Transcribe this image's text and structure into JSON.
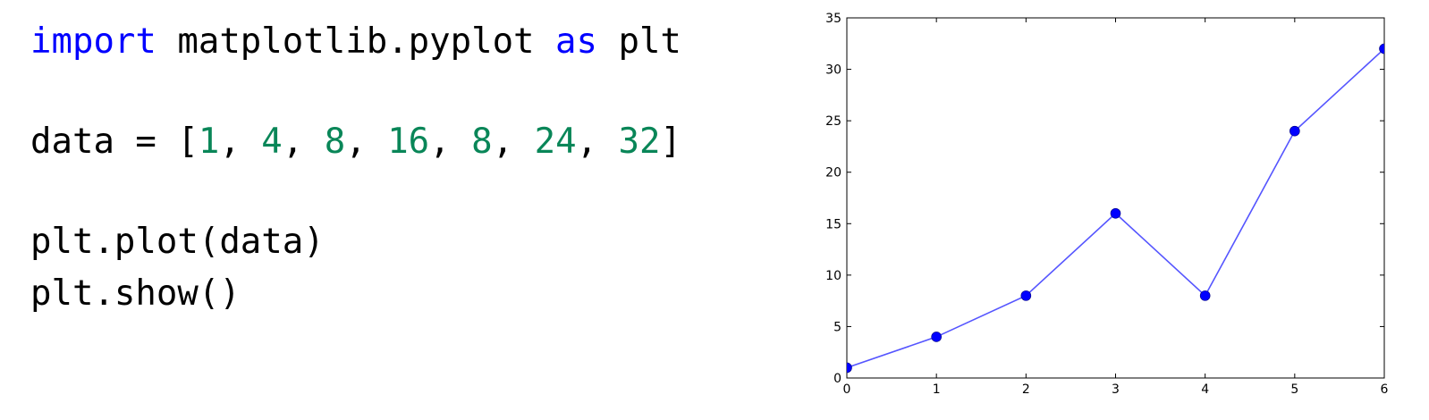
{
  "code": {
    "line1": {
      "kw1": "import",
      "mid": " matplotlib.pyplot ",
      "kw2": "as",
      "end": " plt"
    },
    "line2": {
      "prefix": "data = [",
      "values": [
        "1",
        "4",
        "8",
        "16",
        "8",
        "24",
        "32"
      ],
      "separator": ", ",
      "suffix": "]"
    },
    "line3": "plt.plot(data)",
    "line4": "plt.show()"
  },
  "colors": {
    "keyword": "#0000ff",
    "number": "#098658",
    "line": "#5555ff",
    "marker": "#0000ff"
  },
  "chart_data": {
    "type": "line",
    "x": [
      0,
      1,
      2,
      3,
      4,
      5,
      6
    ],
    "series": [
      {
        "values": [
          1,
          4,
          8,
          16,
          8,
          24,
          32
        ]
      }
    ],
    "xlim": [
      0,
      6
    ],
    "ylim": [
      0,
      35
    ],
    "xticks": [
      "0",
      "1",
      "2",
      "3",
      "4",
      "5",
      "6"
    ],
    "yticks": [
      "0",
      "5",
      "10",
      "15",
      "20",
      "25",
      "30",
      "35"
    ],
    "markers": true,
    "grid": false,
    "legend": false,
    "title": "",
    "xlabel": "",
    "ylabel": ""
  }
}
